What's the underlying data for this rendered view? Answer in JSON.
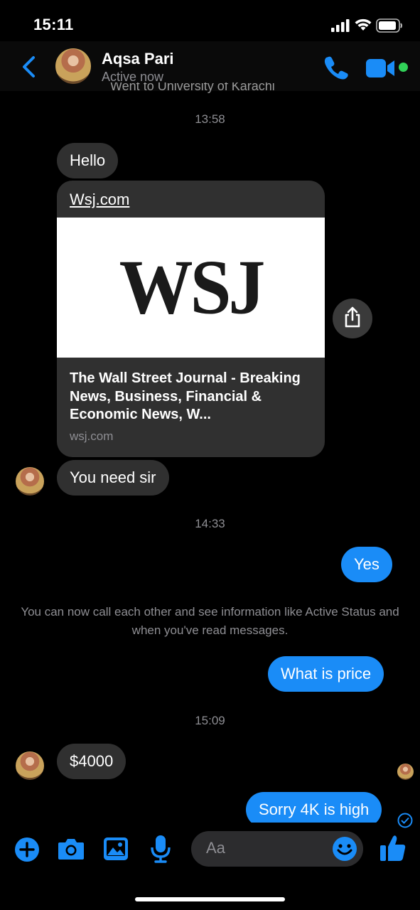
{
  "status_bar": {
    "time": "15:11"
  },
  "header": {
    "contact_name": "Aqsa Pari",
    "presence": "Active now"
  },
  "conversation": {
    "previous_line": "Went to University of Karachi",
    "stamp_1": "13:58",
    "msg_hello": "Hello",
    "link_card": {
      "link": "Wsj.com",
      "logo": "WSJ",
      "title": "The Wall Street Journal - Breaking News, Business, Financial & Economic News, W...",
      "domain": "wsj.com"
    },
    "msg_you_need": "You need sir",
    "stamp_2": "14:33",
    "msg_yes": "Yes",
    "notice": "You can now call each other and see information like Active Status and when you've read messages.",
    "msg_price": "What is price",
    "stamp_3": "15:09",
    "msg_amount": "$4000",
    "msg_sorry": "Sorry 4K is high"
  },
  "composer": {
    "placeholder": "Aa"
  },
  "colors": {
    "accent": "#1a8cf7",
    "incoming": "#303030",
    "online": "#31d158"
  },
  "icons": [
    "back-chevron-icon",
    "phone-icon",
    "video-camera-icon",
    "share-icon",
    "plus-icon",
    "camera-icon",
    "image-icon",
    "microphone-icon",
    "emoji-icon",
    "thumbs-up-icon",
    "sent-check-icon",
    "signal-icon",
    "wifi-icon",
    "battery-icon"
  ]
}
